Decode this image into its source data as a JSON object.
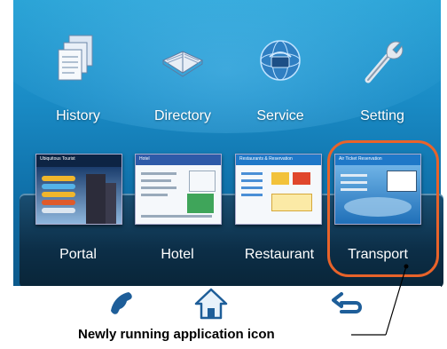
{
  "apps": [
    {
      "label": "History",
      "icon": "history-icon"
    },
    {
      "label": "Directory",
      "icon": "book-icon"
    },
    {
      "label": "Service",
      "icon": "globe-phone-icon"
    },
    {
      "label": "Setting",
      "icon": "wrench-icon"
    }
  ],
  "running": [
    {
      "label": "Portal",
      "thumb_title": "Ubiquitous Tourist"
    },
    {
      "label": "Hotel",
      "thumb_title": "Hotel"
    },
    {
      "label": "Restaurant",
      "thumb_title": "Restaurants & Reservation"
    },
    {
      "label": "Transport",
      "thumb_title": "Air Ticket Reservation"
    }
  ],
  "nav": {
    "phone": "phone-icon",
    "home": "home-icon",
    "back": "back-icon"
  },
  "callout": "Newly running application icon",
  "colors": {
    "highlight": "#e8632a",
    "screen": "#1a8cc6"
  }
}
